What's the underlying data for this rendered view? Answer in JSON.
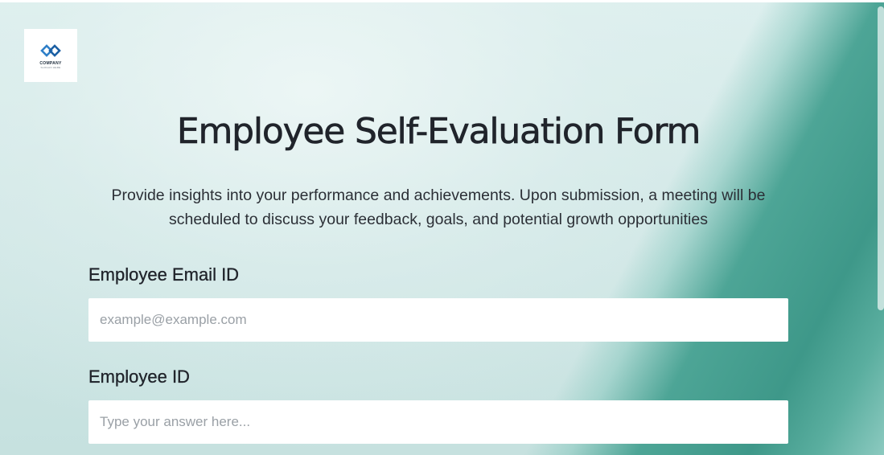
{
  "logo": {
    "icon": "company-logo-icon",
    "name": "COMPANY",
    "tagline": "SLOGAN HERE",
    "colors": {
      "primary": "#2f7fc8",
      "secondary": "#1b2a3a"
    }
  },
  "form": {
    "title": "Employee Self-Evaluation Form",
    "description": "Provide insights into your performance and achievements. Upon submission, a meeting will be scheduled to discuss your feedback, goals, and potential growth opportunities",
    "fields": [
      {
        "label": "Employee Email ID",
        "placeholder": "example@example.com",
        "value": ""
      },
      {
        "label": "Employee ID",
        "placeholder": "Type your answer here...",
        "value": ""
      }
    ]
  },
  "theme": {
    "background": "#d2e8e7",
    "accent": "#4da596",
    "text": "#20242b"
  }
}
